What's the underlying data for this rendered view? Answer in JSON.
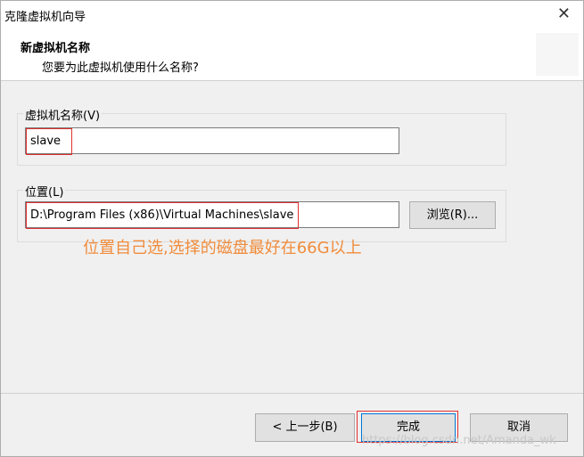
{
  "window": {
    "title": "克隆虚拟机向导",
    "close_glyph": "✕"
  },
  "header": {
    "heading": "新虚拟机名称",
    "subheading": "您要为此虚拟机使用什么名称?"
  },
  "name_group": {
    "label": "虚拟机名称(V)",
    "value": "slave"
  },
  "location_group": {
    "label": "位置(L)",
    "value": "D:\\Program Files (x86)\\Virtual Machines\\slave",
    "browse_label": "浏览(R)..."
  },
  "annotation": "位置自己选,选择的磁盘最好在66G以上",
  "footer": {
    "back_label": "< 上一步(B)",
    "finish_label": "完成",
    "cancel_label": "取消"
  },
  "watermark": "https://blog.csdn.net/Amanda_wk",
  "colors": {
    "highlight": "#e0302e",
    "annotation": "#f08c3c",
    "default_button_border": "#0078d7"
  }
}
